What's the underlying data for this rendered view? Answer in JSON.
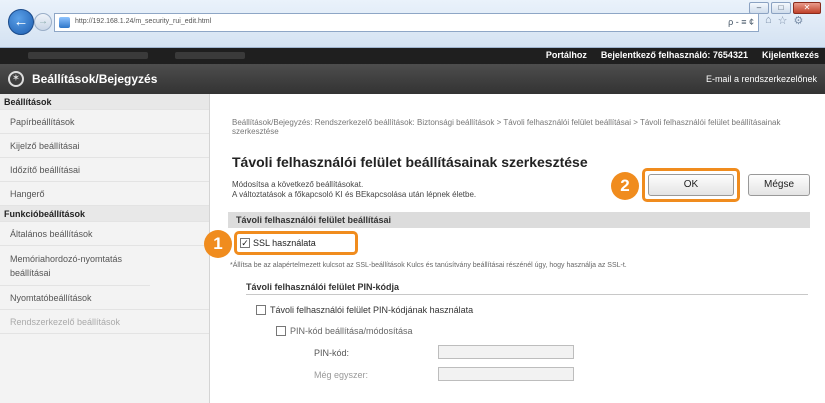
{
  "browser": {
    "url": "http://192.168.1.24/m_security_rui_edit.html",
    "search_placeholder": "ρ - ≡ ¢",
    "window_buttons": [
      "–",
      "□",
      "✕"
    ]
  },
  "header": {
    "top_links": [
      "Portálhoz",
      "Bejelentkező felhasználó:  7654321",
      "Kijelentkezés"
    ],
    "title": "Beállítások/Bejegyzés",
    "mail_link": "E-mail a rendszerkezelőnek"
  },
  "sidebar": {
    "items": [
      {
        "label": "Beállítások",
        "type": "heading"
      },
      {
        "label": "Papírbeállítások",
        "type": "item"
      },
      {
        "label": "Kijelző beállításai",
        "type": "item"
      },
      {
        "label": "Időzítő beállításai",
        "type": "item"
      },
      {
        "label": "Hangerő",
        "type": "item"
      },
      {
        "label": "Funkcióbeállítások",
        "type": "heading"
      },
      {
        "label": "Általános beállítások",
        "type": "item"
      },
      {
        "label": "Memóriahordozó-nyomtatás beállításai",
        "type": "tall"
      },
      {
        "label": "Nyomtatóbeállítások",
        "type": "item"
      },
      {
        "label": "Rendszerkezelő beállítások",
        "type": "muted"
      }
    ]
  },
  "main": {
    "breadcrumb": "Beállítások/Bejegyzés: Rendszerkezelő beállítások: Biztonsági beállítások > Távoli felhasználói felület beállításai > Távoli felhasználói felület beállításainak szerkesztése",
    "title": "Távoli felhasználói felület beállításainak szerkesztése",
    "desc_line1": "Módosítsa a következő beállításokat.",
    "desc_line2": "A változtatások a főkapcsoló KI és BEkapcsolása után lépnek életbe.",
    "ok_label": "OK",
    "cancel_label": "Mégse",
    "section_title": "Távoli felhasználói felület beállításai",
    "ssl_label": "SSL használata",
    "ssl_checked": true,
    "note": "*Állítsa be az alapértelmezett kulcsot az SSL-beállítások Kulcs és tanúsítvány beállításai részénél úgy, hogy használja az SSL-t.",
    "pin_section_title": "Távoli felhasználói felület PIN-kódja",
    "use_pin_label": "Távoli felhasználói felület PIN-kódjának használata",
    "set_pin_label": "PIN-kód beállítása/módosítása",
    "pin_label": "PIN-kód:",
    "confirm_label": "Még egyszer:",
    "badge1": "1",
    "badge2": "2"
  },
  "colors": {
    "callout": "#f08c1e",
    "header_bg": "#333333"
  }
}
